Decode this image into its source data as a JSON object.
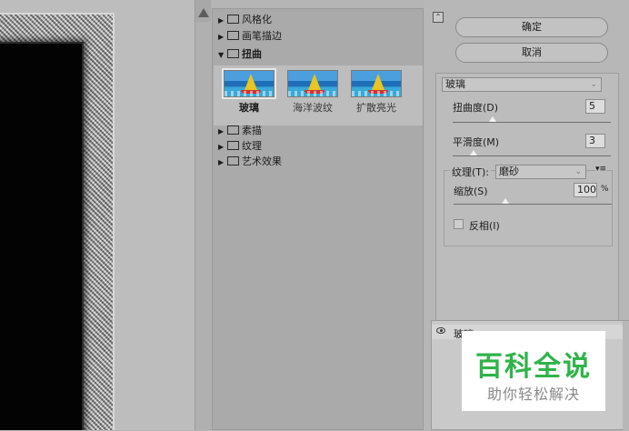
{
  "gallery": {
    "folders_top": [
      {
        "label": "风格化",
        "state": "collapsed"
      },
      {
        "label": "画笔描边",
        "state": "collapsed"
      },
      {
        "label": "扭曲",
        "state": "expanded"
      }
    ],
    "thumbnails": [
      {
        "label": "玻璃",
        "selected": true
      },
      {
        "label": "海洋波纹",
        "selected": false
      },
      {
        "label": "扩散亮光",
        "selected": false
      }
    ],
    "folders_bottom": [
      {
        "label": "素描",
        "state": "collapsed"
      },
      {
        "label": "纹理",
        "state": "collapsed"
      },
      {
        "label": "艺术效果",
        "state": "collapsed"
      }
    ]
  },
  "buttons": {
    "ok": "确定",
    "cancel": "取消"
  },
  "filter": {
    "selected": "玻璃",
    "distortion": {
      "label": "扭曲度(D)",
      "value": "5",
      "fraction": 0.25
    },
    "smoothness": {
      "label": "平滑度(M)",
      "value": "3",
      "fraction": 0.13
    },
    "texture": {
      "label": "纹理(T):",
      "value": "磨砂"
    },
    "scaling": {
      "label": "缩放(S)",
      "value": "100",
      "unit": "%",
      "fraction": 0.33
    },
    "invert": {
      "label": "反相(I)",
      "checked": false
    }
  },
  "layers": {
    "items": [
      {
        "label": "玻璃",
        "visible": true
      }
    ]
  },
  "watermark": {
    "title": "百科全说",
    "subtitle": "助你轻松解决"
  },
  "icons": {
    "collapse": "double-chevron-icon",
    "menu": "panel-menu-icon",
    "eye": "eye-icon"
  }
}
